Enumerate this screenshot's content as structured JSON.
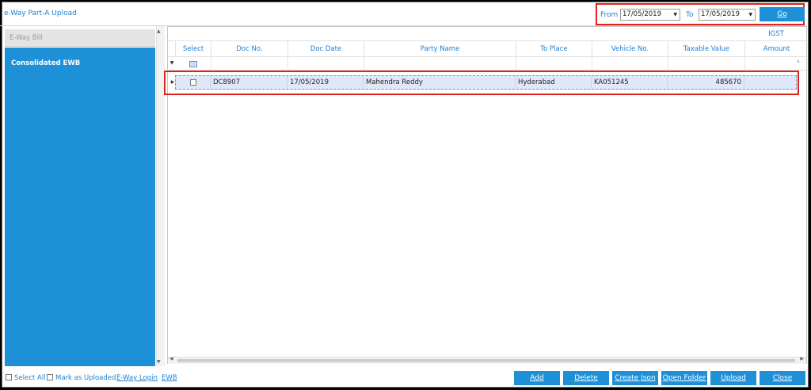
{
  "title": "e-Way Part-A Upload",
  "date_range": {
    "from_label": "From",
    "from_value": "17/05/2019",
    "to_label": "To",
    "to_value": "17/05/2019",
    "go_label": "Go"
  },
  "left_panel": {
    "tab_label": "E-Way Bill",
    "items": [
      "Consolidated EWB"
    ]
  },
  "grid": {
    "group_header": "IGST",
    "columns": [
      "Select",
      "Doc No.",
      "Doc Date",
      "Party Name",
      "To Place",
      "Vehicle No.",
      "Taxable Value",
      "Amount"
    ],
    "rows": [
      {
        "selected": false,
        "doc_no": "DC8907",
        "doc_date": "17/05/2019",
        "party_name": "Mahendra Reddy",
        "to_place": "Hyderabad",
        "vehicle_no": "KA051245",
        "taxable_value": "485670",
        "amount": ""
      }
    ]
  },
  "footer": {
    "select_all": "Select All",
    "mark_uploaded": "Mark as Uploaded",
    "eway_login": "E-Way Login",
    "ewb": "EWB",
    "buttons": {
      "add": "Add",
      "delete": "Delete",
      "create_json": "Create Json",
      "open_folder": "Open Folder",
      "upload": "Upload",
      "close": "Close"
    }
  },
  "colors": {
    "accent": "#1e90d8",
    "highlight_border": "#e0221d",
    "row_selected": "#dfe8f9"
  }
}
